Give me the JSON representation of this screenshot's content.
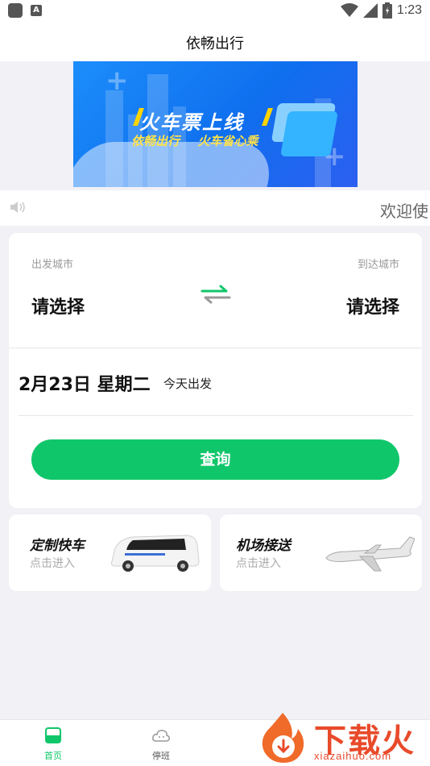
{
  "status_bar": {
    "time": "1:23",
    "battery_glyph": "▮",
    "a_icon": "A"
  },
  "header": {
    "title": "依畅出行"
  },
  "banner": {
    "headline": "火车票上线",
    "sub_left": "依畅出行",
    "sub_right": "火车省心乘"
  },
  "notice": {
    "text": "欢迎使"
  },
  "search": {
    "from_label": "出发城市",
    "from_value": "请选择",
    "to_label": "到达城市",
    "to_value": "请选择",
    "date": "2月23日 星期二",
    "date_note": "今天出发",
    "query_button": "查询"
  },
  "services": [
    {
      "title": "定制快车",
      "subtitle": "点击进入"
    },
    {
      "title": "机场接送",
      "subtitle": "点击进入"
    }
  ],
  "tabs": [
    {
      "label": "首页",
      "active": true
    },
    {
      "label": "停班",
      "active": false
    }
  ],
  "watermark": {
    "text": "下载火",
    "url": "xiazaihuo.com"
  },
  "colors": {
    "accent": "#10c66a",
    "banner_blue": "#0f6fee",
    "watermark": "#e84a2a"
  }
}
